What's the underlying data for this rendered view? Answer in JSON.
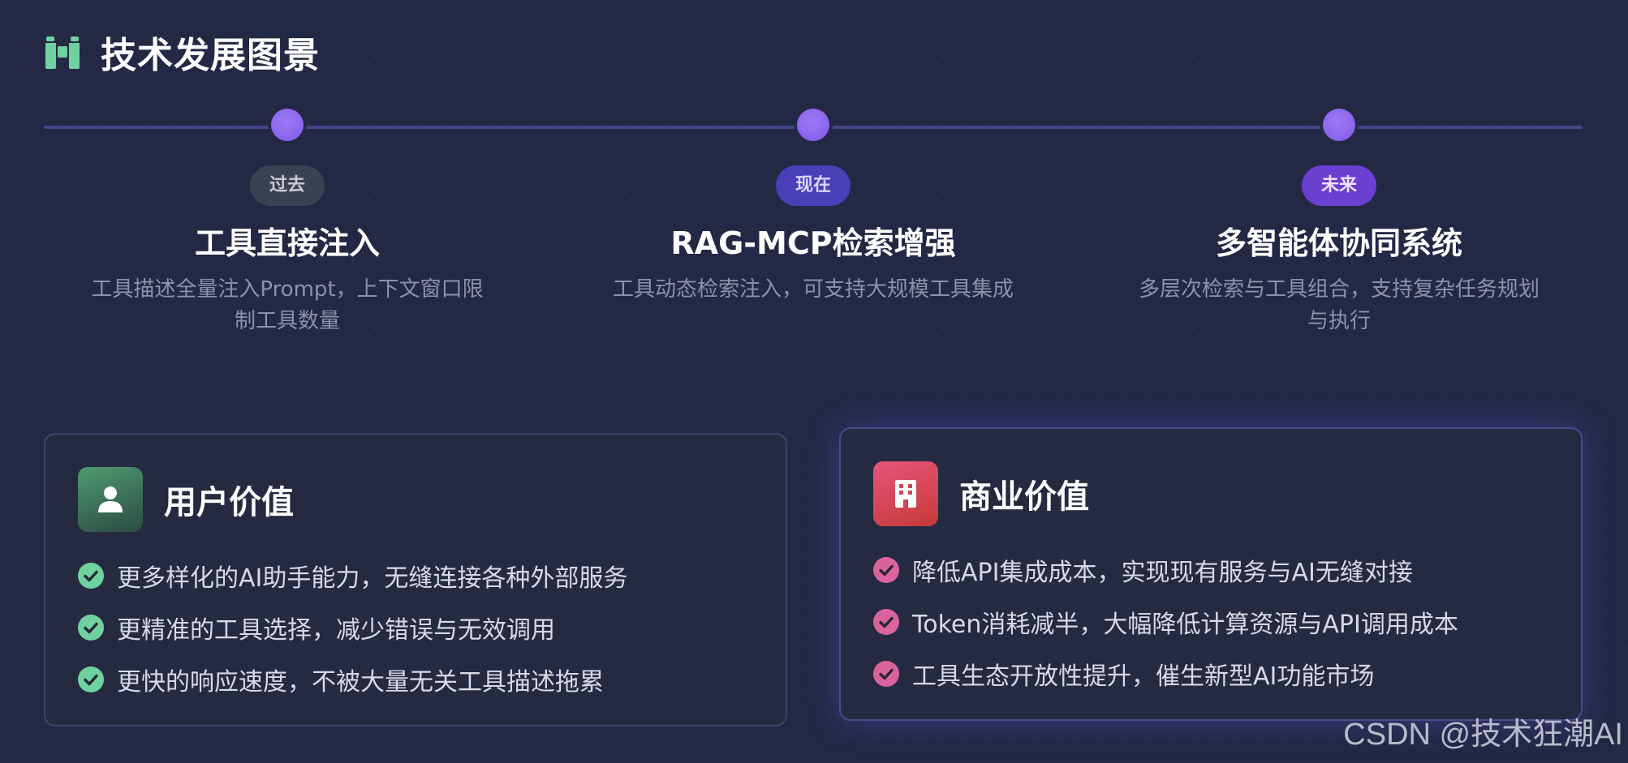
{
  "header": {
    "title": "技术发展图景",
    "icon": "binoculars-icon",
    "icon_color": "#6fd1a0"
  },
  "timeline": {
    "stages": [
      {
        "badge": "过去",
        "title": "工具直接注入",
        "desc_line1": "工具描述全量注入Prompt，上下文窗口限",
        "desc_line2": "制工具数量"
      },
      {
        "badge": "现在",
        "title": "RAG-MCP检索增强",
        "desc_line1": "工具动态检索注入，可支持大规模工具集成",
        "desc_line2": ""
      },
      {
        "badge": "未来",
        "title": "多智能体协同系统",
        "desc_line1": "多层次检索与工具组合，支持复杂任务规划",
        "desc_line2": "与执行"
      }
    ]
  },
  "user_value": {
    "title": "用户价值",
    "icon": "user-icon",
    "check_color": "#6fd1a0",
    "items": [
      "更多样化的AI助手能力，无缝连接各种外部服务",
      "更精准的工具选择，减少错误与无效调用",
      "更快的响应速度，不被大量无关工具描述拖累"
    ]
  },
  "business_value": {
    "title": "商业价值",
    "icon": "building-icon",
    "check_color": "#d9649b",
    "items": [
      "降低API集成成本，实现现有服务与AI无缝对接",
      "Token消耗减半，大幅降低计算资源与API调用成本",
      "工具生态开放性提升，催生新型AI功能市场"
    ]
  },
  "watermark": "CSDN @技术狂潮AI"
}
